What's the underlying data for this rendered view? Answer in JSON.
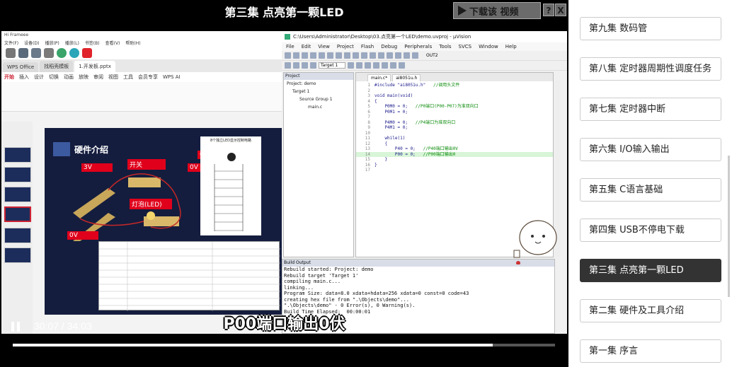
{
  "player": {
    "title": "第三集 点亮第一颗LED",
    "download_label": "下载该 视频",
    "help_label": "?",
    "close_label": "X",
    "subtitle": "P00端口输出0伏",
    "current_time": "30:07",
    "duration": "34:03",
    "time_separator": " / ",
    "progress": 0.885
  },
  "wps": {
    "app_title": "Hi Frameee",
    "menu": [
      "文件(F)",
      "设备(D)",
      "播放(P)",
      "播放(L)",
      "书签(B)",
      "查看(V)",
      "帮助(H)"
    ],
    "tabs": [
      {
        "label": "WPS Office",
        "active": false
      },
      {
        "label": "找稻壳模板",
        "active": false
      },
      {
        "label": "1.开发板.pptx",
        "active": true
      }
    ],
    "ribbon_tabs": [
      "开始",
      "插入",
      "设计",
      "切换",
      "动画",
      "放映",
      "审阅",
      "视图",
      "工具",
      "会员专享",
      "WPS AI"
    ],
    "ribbon_active": "开始",
    "slide_title": "硬件介绍",
    "tags": {
      "v3": "3V",
      "switch": "开关",
      "led": "灯泡(LED)",
      "ov_left": "0V",
      "ov_top1": "0V",
      "ov_top2": "0V"
    },
    "schematic_title": "8个独立LED显示控制电路"
  },
  "keil": {
    "title": "C:\\Users\\Administrator\\Desktop\\03.点亮第一个LED\\demo.uvproj - µVision",
    "menu": [
      "File",
      "Edit",
      "View",
      "Project",
      "Flash",
      "Debug",
      "Peripherals",
      "Tools",
      "SVCS",
      "Window",
      "Help"
    ],
    "target": "Target 1",
    "out": "OUT2",
    "project_header": "Project",
    "tree": [
      "Project: demo",
      "Target 1",
      "Source Group 1",
      "main.c"
    ],
    "editor_tabs": [
      "main.c*",
      "ai8051u.h"
    ],
    "code": [
      {
        "n": "1",
        "text": "#include \"ai8051u.h\"",
        "comment": "//调用头文件"
      },
      {
        "n": "2",
        "text": "",
        "comment": ""
      },
      {
        "n": "3",
        "text": "void main(void)",
        "comment": ""
      },
      {
        "n": "4",
        "text": "{",
        "comment": ""
      },
      {
        "n": "5",
        "text": "    P0M0 = 0;",
        "comment": "//P0端口(P00-P07)为准双向口"
      },
      {
        "n": "6",
        "text": "    P0M1 = 0;",
        "comment": ""
      },
      {
        "n": "7",
        "text": "",
        "comment": ""
      },
      {
        "n": "8",
        "text": "    P4M0 = 0;",
        "comment": "//P4端口为准双向口"
      },
      {
        "n": "9",
        "text": "    P4M1 = 0;",
        "comment": ""
      },
      {
        "n": "10",
        "text": "",
        "comment": ""
      },
      {
        "n": "11",
        "text": "    while(1)",
        "comment": ""
      },
      {
        "n": "12",
        "text": "    {",
        "comment": ""
      },
      {
        "n": "13",
        "text": "        P40 = 0;",
        "comment": "//P40端口输出0V"
      },
      {
        "n": "14",
        "text": "        P00 = 0;",
        "comment": "//P00端口输出0"
      },
      {
        "n": "15",
        "text": "    }",
        "comment": ""
      },
      {
        "n": "16",
        "text": "}",
        "comment": ""
      },
      {
        "n": "17",
        "text": "",
        "comment": ""
      }
    ],
    "build_header": "Build Output",
    "build_lines": [
      "Rebuild started: Project: demo",
      "Rebuild target 'Target 1'",
      "compiling main.c...",
      "linking...",
      "Program Size: data=8.0 xdata+hdata=256 xdata=0 const=0 code=43",
      "creating hex file from \".\\Objects\\demo\"...",
      "\".\\Objects\\demo\" - 0 Error(s), 0 Warning(s).",
      "Build Time Elapsed:  00:00:01"
    ]
  },
  "playlist": {
    "episodes": [
      {
        "label": "第九集 数码管",
        "active": false
      },
      {
        "label": "第八集 定时器周期性调度任务",
        "active": false
      },
      {
        "label": "第七集 定时器中断",
        "active": false
      },
      {
        "label": "第六集 I/O输入输出",
        "active": false
      },
      {
        "label": "第五集 C语言基础",
        "active": false
      },
      {
        "label": "第四集 USB不停电下载",
        "active": false
      },
      {
        "label": "第三集 点亮第一颗LED",
        "active": true
      },
      {
        "label": "第二集 硬件及工具介绍",
        "active": false
      },
      {
        "label": "第一集 序言",
        "active": false
      }
    ]
  }
}
